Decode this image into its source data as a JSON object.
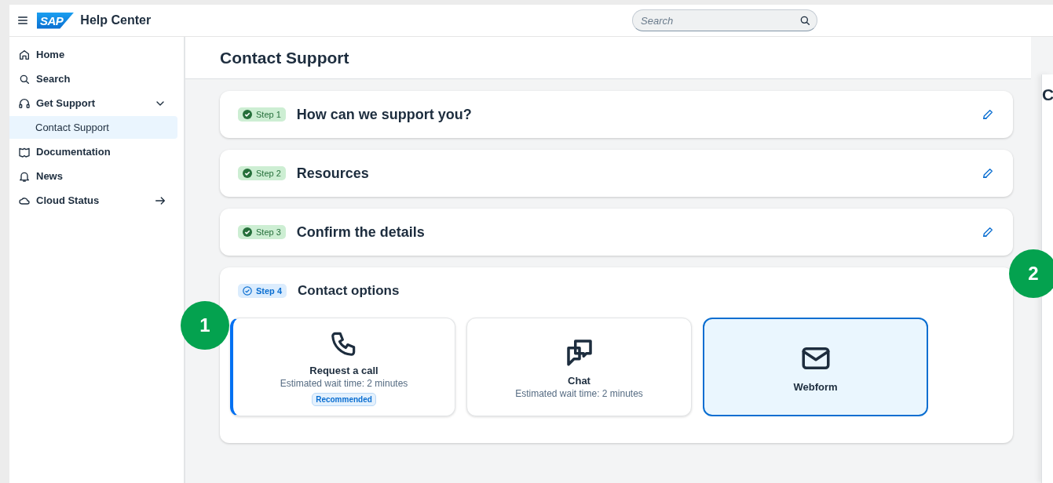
{
  "topbar": {
    "logo": "SAP",
    "title": "Help Center",
    "search": {
      "placeholder": "Search"
    }
  },
  "sidebar": {
    "items": [
      {
        "label": "Home",
        "kind": "home",
        "selected": false
      },
      {
        "label": "Search",
        "kind": "search",
        "selected": false
      },
      {
        "label": "Get Support",
        "kind": "headset",
        "selected": false,
        "expanded": true,
        "children": [
          {
            "label": "Contact Support",
            "selected": true
          }
        ]
      },
      {
        "label": "Documentation",
        "kind": "book",
        "selected": false
      },
      {
        "label": "News",
        "kind": "bell",
        "selected": false
      },
      {
        "label": "Cloud Status",
        "kind": "cloud",
        "selected": false,
        "external": true
      }
    ]
  },
  "page": {
    "title": "Contact Support"
  },
  "steps": [
    {
      "badge": "Step 1",
      "title": "How can we support you?",
      "completed": true
    },
    {
      "badge": "Step 2",
      "title": "Resources",
      "completed": true
    },
    {
      "badge": "Step 3",
      "title": "Confirm the details",
      "completed": true
    },
    {
      "badge": "Step 4",
      "title": "Contact options",
      "completed": false,
      "options": [
        {
          "kind": "phone",
          "title": "Request a call",
          "subtitle": "Estimated wait time: 2 minutes",
          "tag": "Recommended",
          "selected": false,
          "accent": true
        },
        {
          "kind": "chat",
          "title": "Chat",
          "subtitle": "Estimated wait time: 2 minutes",
          "selected": false,
          "accent": false
        },
        {
          "kind": "mail",
          "title": "Webform",
          "selected": true,
          "accent": false
        }
      ]
    }
  ],
  "side_panel": {
    "title": "C"
  },
  "annotations": [
    "1",
    "2"
  ]
}
